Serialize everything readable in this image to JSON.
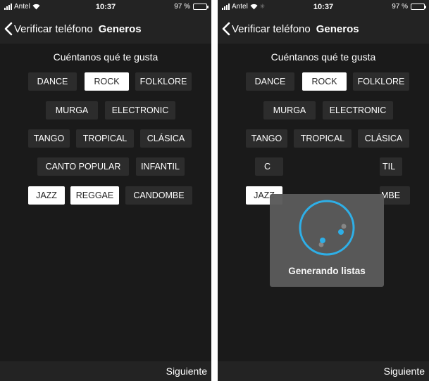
{
  "colors": {
    "background": "#1a1a1a",
    "bar": "#232323",
    "chip": "#2c2c2c",
    "chip_selected": "#ffffff",
    "accent": "#2fb4ee"
  },
  "icons": {
    "back": "chevron-left-icon",
    "signal": "signal-bars-icon",
    "wifi": "wifi-icon",
    "battery": "battery-icon",
    "spinner": "loading-spinner-icon"
  },
  "screens": [
    {
      "status": {
        "carrier": "Antel",
        "time": "10:37",
        "battery": "97 %"
      },
      "nav": {
        "back_label": "Verificar teléfono",
        "title": "Generos"
      },
      "prompt": "Cuéntanos qué te gusta",
      "genres": [
        {
          "label": "DANCE",
          "selected": false
        },
        {
          "label": "ROCK",
          "selected": true
        },
        {
          "label": "FOLKLORE",
          "selected": false
        },
        {
          "label": "MURGA",
          "selected": false
        },
        {
          "label": "ELECTRONIC",
          "selected": false
        },
        {
          "label": "TANGO",
          "selected": false
        },
        {
          "label": "TROPICAL",
          "selected": false
        },
        {
          "label": "CLÁSICA",
          "selected": false
        },
        {
          "label": "CANTO POPULAR",
          "selected": false
        },
        {
          "label": "INFANTIL",
          "selected": false
        },
        {
          "label": "JAZZ",
          "selected": true
        },
        {
          "label": "REGGAE",
          "selected": true
        },
        {
          "label": "CANDOMBE",
          "selected": false
        }
      ],
      "next_label": "Siguiente"
    },
    {
      "status": {
        "carrier": "Antel",
        "time": "10:37",
        "battery": "97 %"
      },
      "nav": {
        "back_label": "Verificar teléfono",
        "title": "Generos"
      },
      "prompt": "Cuéntanos qué te gusta",
      "genres": [
        {
          "label": "DANCE",
          "selected": false
        },
        {
          "label": "ROCK",
          "selected": true
        },
        {
          "label": "FOLKLORE",
          "selected": false
        },
        {
          "label": "MURGA",
          "selected": false
        },
        {
          "label": "ELECTRONIC",
          "selected": false
        },
        {
          "label": "TANGO",
          "selected": false
        },
        {
          "label": "TROPICAL",
          "selected": false
        },
        {
          "label": "CLÁSICA",
          "selected": false
        },
        {
          "label": "C",
          "selected": false
        },
        {
          "label": "TIL",
          "selected": false
        },
        {
          "label": "JAZZ",
          "selected": true
        },
        {
          "label": "MBE",
          "selected": false
        }
      ],
      "loading": {
        "label": "Generando listas"
      },
      "next_label": "Siguiente"
    }
  ]
}
